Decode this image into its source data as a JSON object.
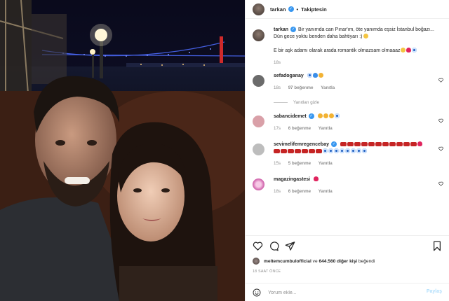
{
  "post": {
    "username": "tarkan",
    "follow_state": "Takiptesin",
    "caption": {
      "line1": "Bir yanımda can Pınar'ım, öte yanımda eşsiz İstanbul boğazı...",
      "line2": "Dün gece yoktu benden daha bahtiyarı :)",
      "line3": "E bir aşk adamı olarak arada romantik olmazsam olmaaaz",
      "time": "18s"
    }
  },
  "comments": [
    {
      "username": "sefadoganay",
      "time": "18s",
      "likes": "97 beğenme",
      "reply": "Yanıtla",
      "avatar_color": "#6b6b6b"
    },
    {
      "username": "sabancidemet",
      "time": "17s",
      "likes": "6 beğenme",
      "reply": "Yanıtla",
      "avatar_color": "#d9a0a8"
    },
    {
      "username": "sevimelifemregencebay",
      "time": "15s",
      "likes": "5 beğenme",
      "reply": "Yanıtla",
      "avatar_color": "#bdbdbd"
    },
    {
      "username": "magazingastesi",
      "time": "18s",
      "likes": "6 beğenme",
      "reply": "Yanıtla",
      "avatar_color": "#c23d96"
    }
  ],
  "hide_replies": "Yanıtları gizle",
  "likes_line": {
    "liker": "meltemcumbulofficial",
    "and": "ve",
    "others": "644.560 diğer kişi",
    "suffix": "beğendi"
  },
  "timestamp": "18 SAAT ÖNCE",
  "comment_box": {
    "placeholder": "Yorum ekle...",
    "share_label": "Paylaş"
  },
  "colors": {
    "accent": "#3897f0",
    "muted": "#8e8e8e",
    "border": "#efefef"
  }
}
